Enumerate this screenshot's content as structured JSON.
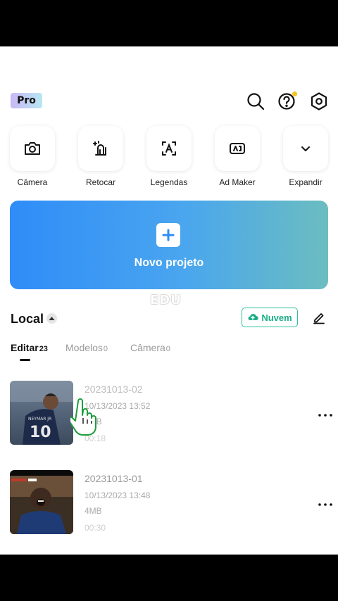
{
  "header": {
    "pro_badge": "Pro",
    "icons": [
      "search-icon",
      "help-icon",
      "settings-icon"
    ],
    "notification_dot_color": "#f7c41c"
  },
  "tools": [
    {
      "label": "Câmera",
      "icon": "camera-icon"
    },
    {
      "label": "Retocar",
      "icon": "retouch-icon"
    },
    {
      "label": "Legendas",
      "icon": "captions-icon"
    },
    {
      "label": "Ad Maker",
      "icon": "ad-maker-icon"
    },
    {
      "label": "Expandir",
      "icon": "chevron-down-icon"
    }
  ],
  "new_project": {
    "label": "Novo projeto",
    "icon": "plus-icon"
  },
  "watermark": "EDU",
  "local": {
    "title": "Local",
    "cloud_button": "Nuvem"
  },
  "tabs": [
    {
      "label": "Editar",
      "count": "23",
      "active": true
    },
    {
      "label": "Modelos",
      "count": "0",
      "active": false
    },
    {
      "label": "Câmera",
      "count": "0",
      "active": false
    }
  ],
  "projects": [
    {
      "name": "20231013-02",
      "date": "10/13/2023 13:52",
      "size": "4MB",
      "duration": "00:18"
    },
    {
      "name": "20231013-01",
      "date": "10/13/2023 13:48",
      "size": "4MB",
      "duration": "00:30"
    }
  ],
  "colors": {
    "accent_blue": "#2f8cf8",
    "accent_teal": "#6bbdc0",
    "cloud_green": "#1aae88"
  }
}
